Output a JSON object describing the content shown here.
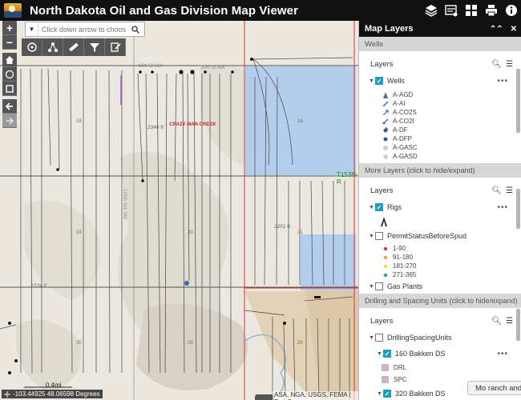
{
  "app": {
    "title": "North Dakota Oil and Gas Division Map Viewer"
  },
  "header_icons": [
    "layers-icon",
    "basemap-icon",
    "grid-icon",
    "print-icon",
    "info-icon"
  ],
  "search": {
    "placeholder": "Click down arrow to choos"
  },
  "toolbar": {
    "icons": [
      "identify-icon",
      "share-icon",
      "measure-icon",
      "filter-icon",
      "edit-icon"
    ]
  },
  "map": {
    "labels": {
      "creek": "CRAZY MAN CREEK",
      "township": "T153N-R",
      "elev1": "2346 ft",
      "elev2": "2251 ft",
      "elev3": "2224 ft",
      "road1": "46th St NW",
      "road2": "30th St NW",
      "road3": "125th Ave NW",
      "sec18": "18",
      "sec16": "16",
      "sec19": "19",
      "sec20": "20",
      "sec21": "21",
      "sec29": "29",
      "sec28": "28",
      "sec30": "30"
    },
    "scale": "0.4mi",
    "coords": "-103.44925 48.06598 Degrees",
    "attribution": "ASA, NGA, USGS, FEMA | Esri Con"
  },
  "panel": {
    "title": "Map Layers",
    "sections": {
      "wells": "Wells",
      "more": "More Layers (click to hide/expand)",
      "drilling": "Drilling and Spacing Units (click to hide/expand)"
    },
    "layers_label": "Layers",
    "wells_layer": "Wells",
    "wells_legend": [
      "A-AGD",
      "A-AI",
      "A-CO2S",
      "A-CO2I",
      "A-DF",
      "A-DFP",
      "A-GASC",
      "A-GASD"
    ],
    "rigs": "Rigs",
    "permit": "PermitStatusBeforeSpud",
    "permit_legend": [
      "1-90",
      "91-180",
      "181-270",
      "271-365"
    ],
    "permit_colors": [
      "#e0322d",
      "#f2a01f",
      "#e8e23a",
      "#1f9cc1"
    ],
    "gas_plants": "Gas Plants",
    "dsu": "DrillingSpacingUnits",
    "bakken160": "160 Bakken DS",
    "bakken320": "320 Bakken DS",
    "drl": "DRL",
    "spc": "SPC"
  },
  "tooltip": "Mo ranch and Ga"
}
